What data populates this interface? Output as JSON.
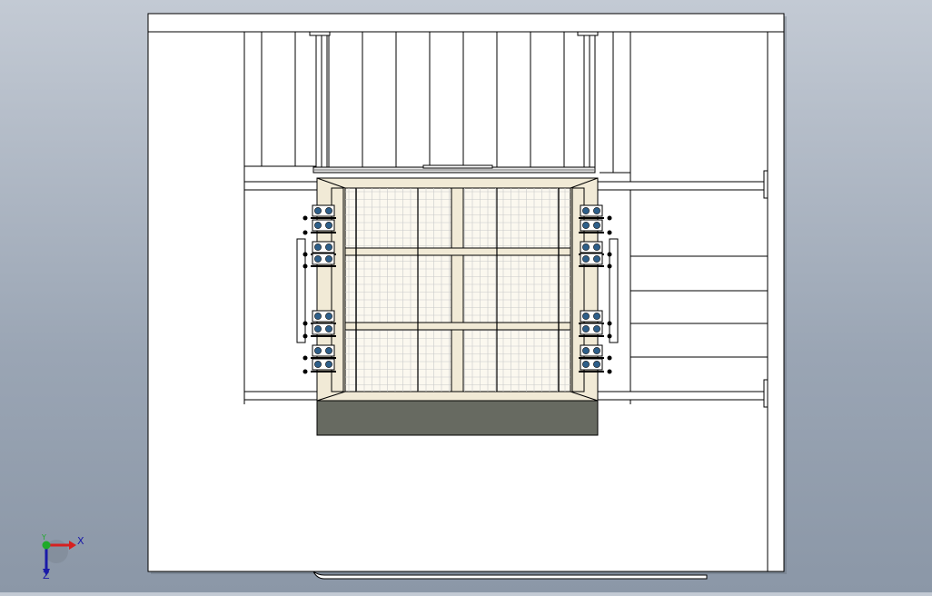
{
  "app": {
    "view": "cad-drawing-viewport"
  },
  "triad": {
    "x_label": "X",
    "y_label": "Y",
    "z_label": "Z"
  },
  "colors": {
    "background_top": "#c3cad4",
    "background_bottom": "#8b97a7",
    "sheet": "#ffffff",
    "frame_fill": "#f1ead6",
    "grate_fill": "#fbf8ef",
    "base_block": "#676a61",
    "bearing_blue": "#2e5f8a",
    "line": "#000000",
    "triad_x": "#d62020",
    "triad_y": "#1faa2a",
    "triad_z": "#1a1aa8"
  }
}
